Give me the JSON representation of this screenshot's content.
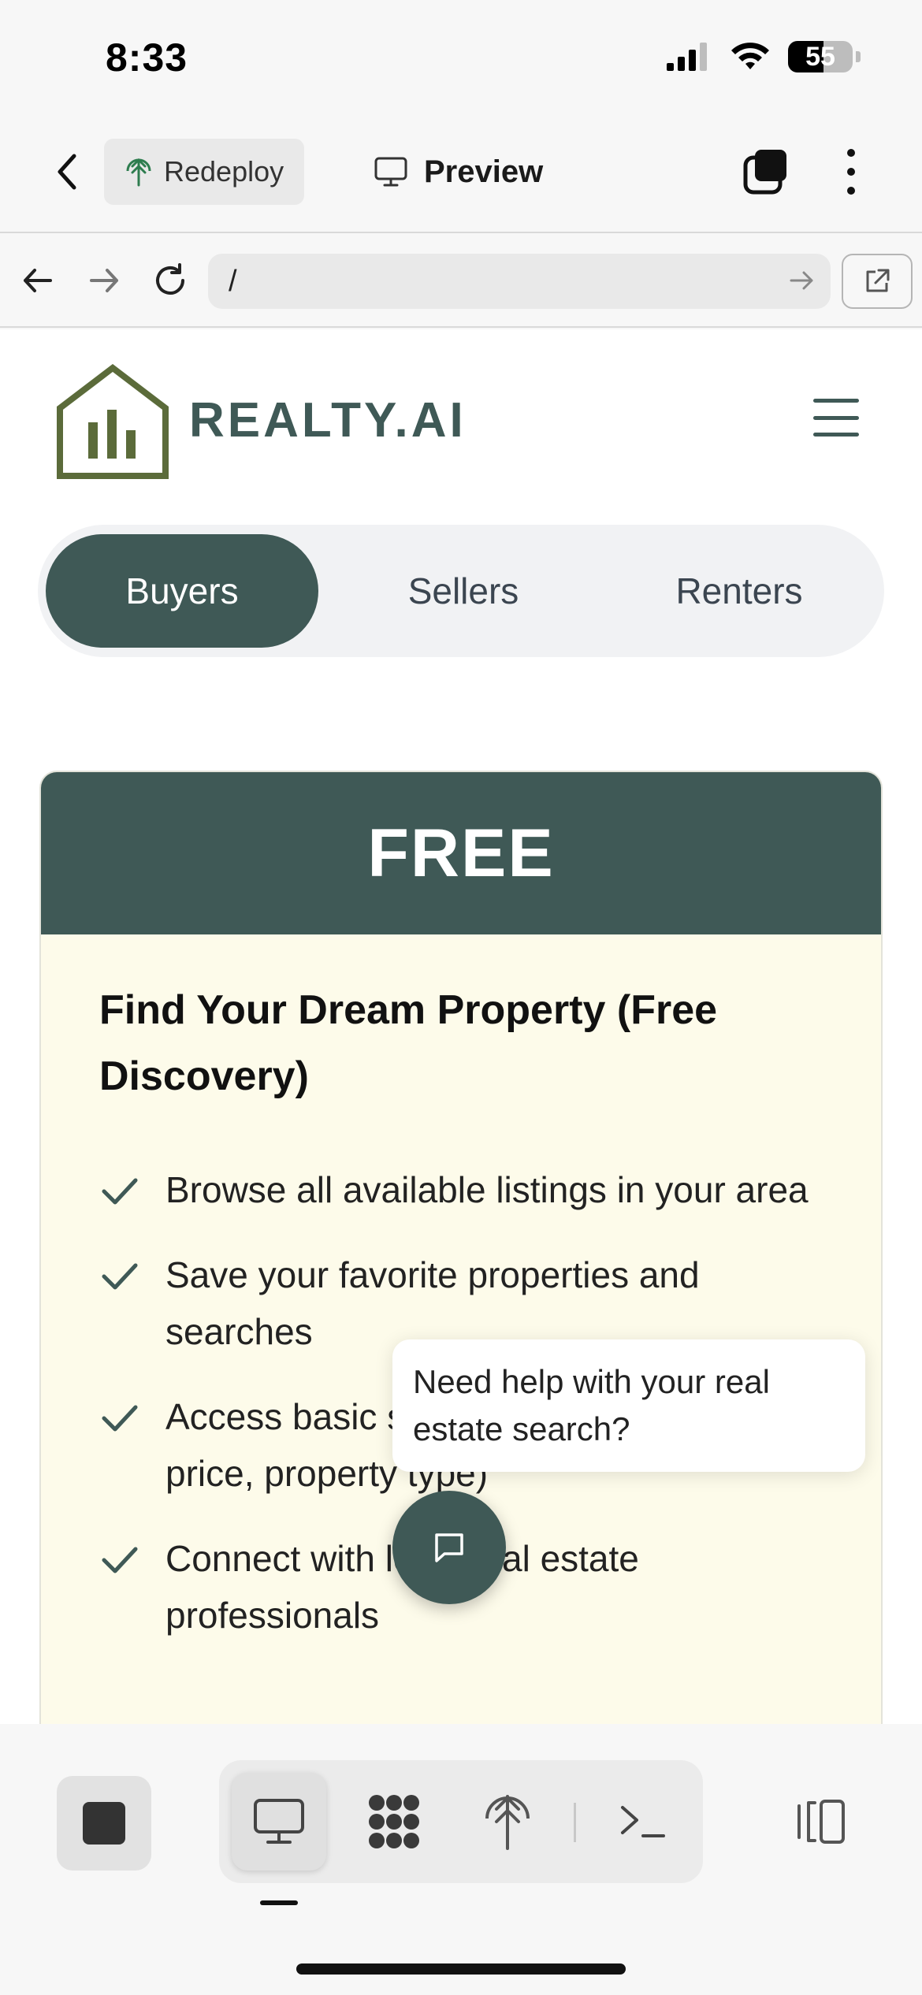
{
  "status_bar": {
    "time": "8:33",
    "battery": "55",
    "battery_level": 0.55
  },
  "toolbar": {
    "redeploy_label": "Redeploy",
    "preview_label": "Preview"
  },
  "url_bar": {
    "value": "/"
  },
  "site": {
    "brand": "REALTY.AI",
    "tabs": [
      {
        "label": "Buyers",
        "active": true
      },
      {
        "label": "Sellers",
        "active": false
      },
      {
        "label": "Renters",
        "active": false
      }
    ],
    "card": {
      "header": "FREE",
      "title": "Find Your Dream Property (Free Discovery)",
      "features": [
        "Browse all available listings in your area",
        "Save your favorite properties and searches",
        "Access basic search filters (location, price, property type)",
        "Connect with local real estate professionals"
      ]
    },
    "chat": {
      "prompt": "Need help with your real estate search?"
    }
  },
  "colors": {
    "brand": "#3f5956",
    "logo_olive": "#5b6b3a",
    "card_bg": "#fdfbea"
  },
  "icons": {
    "back": "chevron-left-icon",
    "redeploy": "deploy-icon",
    "preview": "monitor-icon",
    "tabs": "tabs-icon",
    "more": "more-vertical-icon",
    "chat": "chat-icon",
    "check": "check-icon"
  }
}
